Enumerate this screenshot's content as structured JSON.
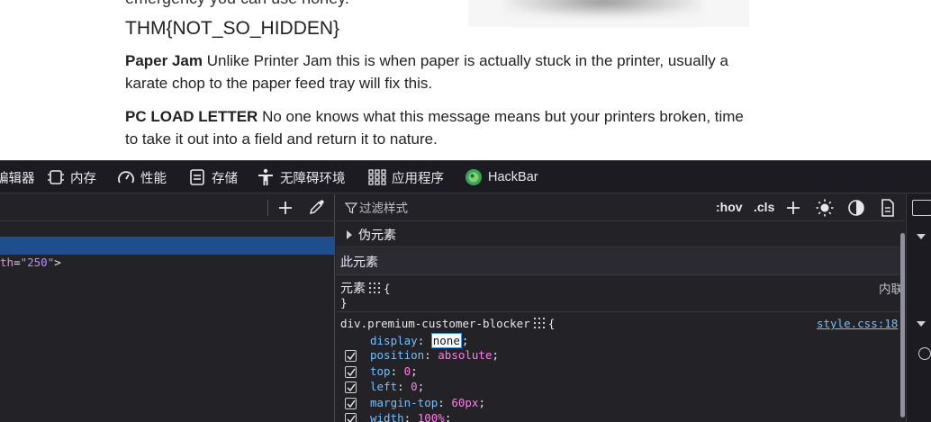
{
  "page": {
    "top_line": "emergency you can use honey.",
    "flag": "THM{NOT_SO_HIDDEN}",
    "paragraphs": [
      {
        "term": "Paper Jam",
        "text": " Unlike Printer Jam this is when paper is actually stuck in the printer, usually a karate chop to the paper feed tray will fix this."
      },
      {
        "term": "PC LOAD LETTER",
        "text": " No one knows what this message means but your printers broken, time to take it out into a field and return it to nature."
      }
    ]
  },
  "devtools": {
    "tabs": [
      {
        "label": "样式编辑器",
        "icon": "style-editor-icon"
      },
      {
        "label": "内存",
        "icon": "memory-icon"
      },
      {
        "label": "性能",
        "icon": "performance-icon"
      },
      {
        "label": "存储",
        "icon": "storage-icon"
      },
      {
        "label": "无障碍环境",
        "icon": "accessibility-icon"
      },
      {
        "label": "应用程序",
        "icon": "application-icon"
      },
      {
        "label": "HackBar",
        "icon": "hackbar-icon"
      }
    ],
    "dom": {
      "attr_name": "th",
      "attr_value": "\"250\"",
      "tail": ">"
    },
    "rules": {
      "filter_placeholder": "过滤样式",
      "hov": ":hov",
      "cls": ".cls",
      "pseudo_elements": "伪元素",
      "this_element": "此元素",
      "element_selector": "元素",
      "element_source": "内联",
      "open_brace": "{",
      "close_brace": "}",
      "css_selector": "div.premium-customer-blocker",
      "css_source": "style.css:18",
      "declarations": [
        {
          "prop": "display",
          "value": "none",
          "checked": true,
          "editing": true
        },
        {
          "prop": "position",
          "value": "absolute",
          "checked": true,
          "editing": false
        },
        {
          "prop": "top",
          "value": "0",
          "checked": true,
          "editing": false
        },
        {
          "prop": "left",
          "value": "0",
          "checked": true,
          "editing": false
        },
        {
          "prop": "margin-top",
          "value": "60px",
          "checked": true,
          "editing": false
        },
        {
          "prop": "width",
          "value": "100%",
          "checked": true,
          "editing": false
        }
      ]
    }
  },
  "colors": {
    "devtools_bg": "#232327",
    "selection": "#204e8a",
    "property": "#75bfff",
    "value": "#ff7de9",
    "link": "#75bfff"
  }
}
